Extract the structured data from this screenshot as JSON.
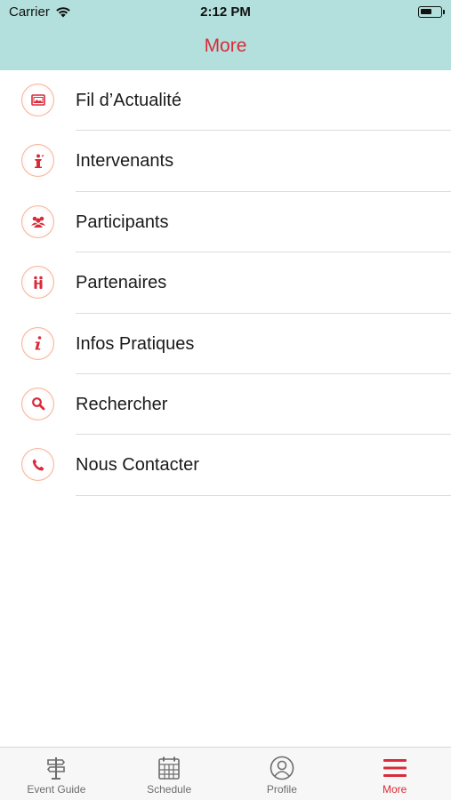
{
  "status_bar": {
    "carrier": "Carrier",
    "time": "2:12 PM"
  },
  "header": {
    "title": "More"
  },
  "menu": {
    "items": [
      {
        "label": "Fil d’Actualité",
        "icon": "news-feed-icon"
      },
      {
        "label": "Intervenants",
        "icon": "speaker-podium-icon"
      },
      {
        "label": "Participants",
        "icon": "people-group-icon"
      },
      {
        "label": "Partenaires",
        "icon": "partners-handshake-icon"
      },
      {
        "label": "Infos Pratiques",
        "icon": "info-icon"
      },
      {
        "label": "Rechercher",
        "icon": "search-icon"
      },
      {
        "label": "Nous Contacter",
        "icon": "phone-icon"
      }
    ]
  },
  "tab_bar": {
    "tabs": [
      {
        "label": "Event Guide",
        "icon": "signpost-icon",
        "active": false
      },
      {
        "label": "Schedule",
        "icon": "calendar-icon",
        "active": false
      },
      {
        "label": "Profile",
        "icon": "profile-icon",
        "active": false
      },
      {
        "label": "More",
        "icon": "menu-icon",
        "active": true
      }
    ]
  },
  "colors": {
    "accent": "#d92b3a",
    "header_bg": "#b3e0dc",
    "icon_ring": "#f5b49a",
    "inactive_tab": "#6d6d6d"
  }
}
